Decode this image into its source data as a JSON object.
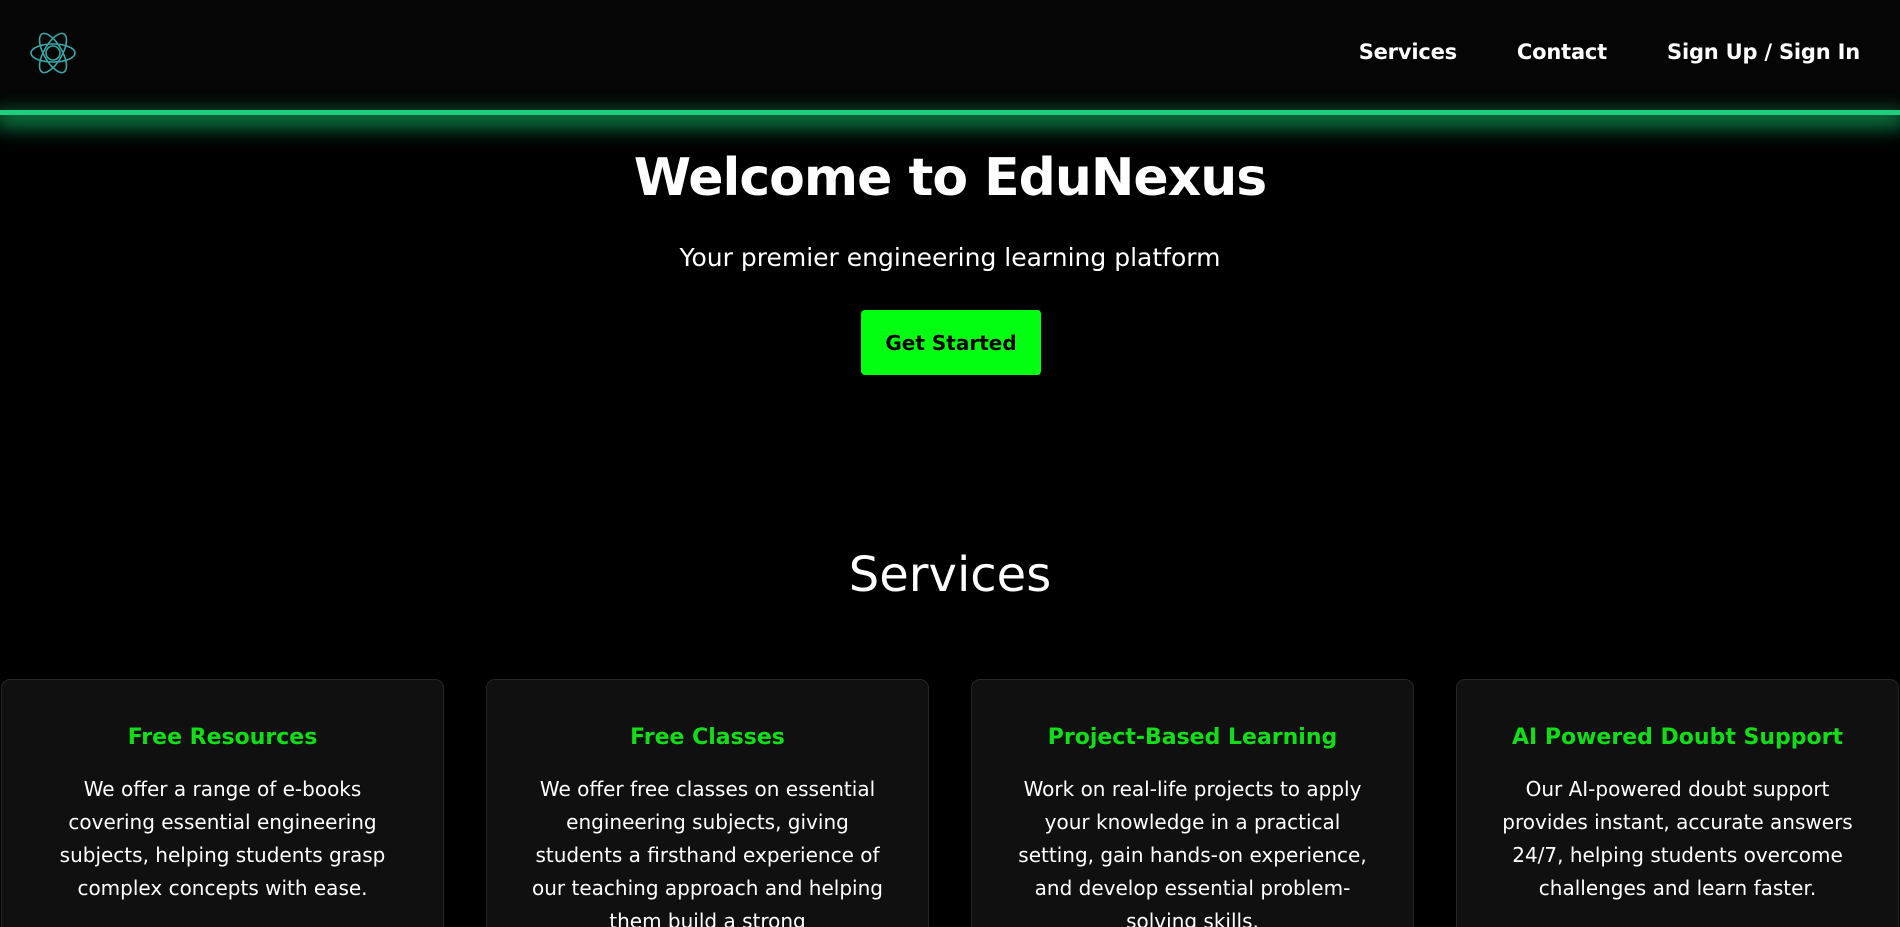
{
  "header": {
    "logo_icon": "atom-icon",
    "nav": [
      {
        "label": "Services"
      },
      {
        "label": "Contact"
      },
      {
        "label": "Sign Up / Sign In"
      }
    ]
  },
  "hero": {
    "title": "Welcome to EduNexus",
    "subtitle": "Your premier engineering learning platform",
    "cta_label": "Get Started"
  },
  "services": {
    "title": "Services",
    "cards": [
      {
        "title": "Free Resources",
        "description": "We offer a range of e-books covering essential engineering subjects, helping students grasp complex concepts with ease."
      },
      {
        "title": "Free Classes",
        "description": "We offer free classes on essential engineering subjects, giving students a firsthand experience of our teaching approach and helping them build a strong"
      },
      {
        "title": "Project-Based Learning",
        "description": "Work on real-life projects to apply your knowledge in a practical setting, gain hands-on experience, and develop essential problem-solving skills."
      },
      {
        "title": "AI Powered Doubt Support",
        "description": "Our AI-powered doubt support provides instant, accurate answers 24/7, helping students overcome challenges and learn faster."
      }
    ]
  },
  "colors": {
    "accent_green": "#00ff11",
    "card_title_green": "#12dd19",
    "header_glow": "#1fcf7e",
    "logo_stroke": "#3aa6a6"
  }
}
